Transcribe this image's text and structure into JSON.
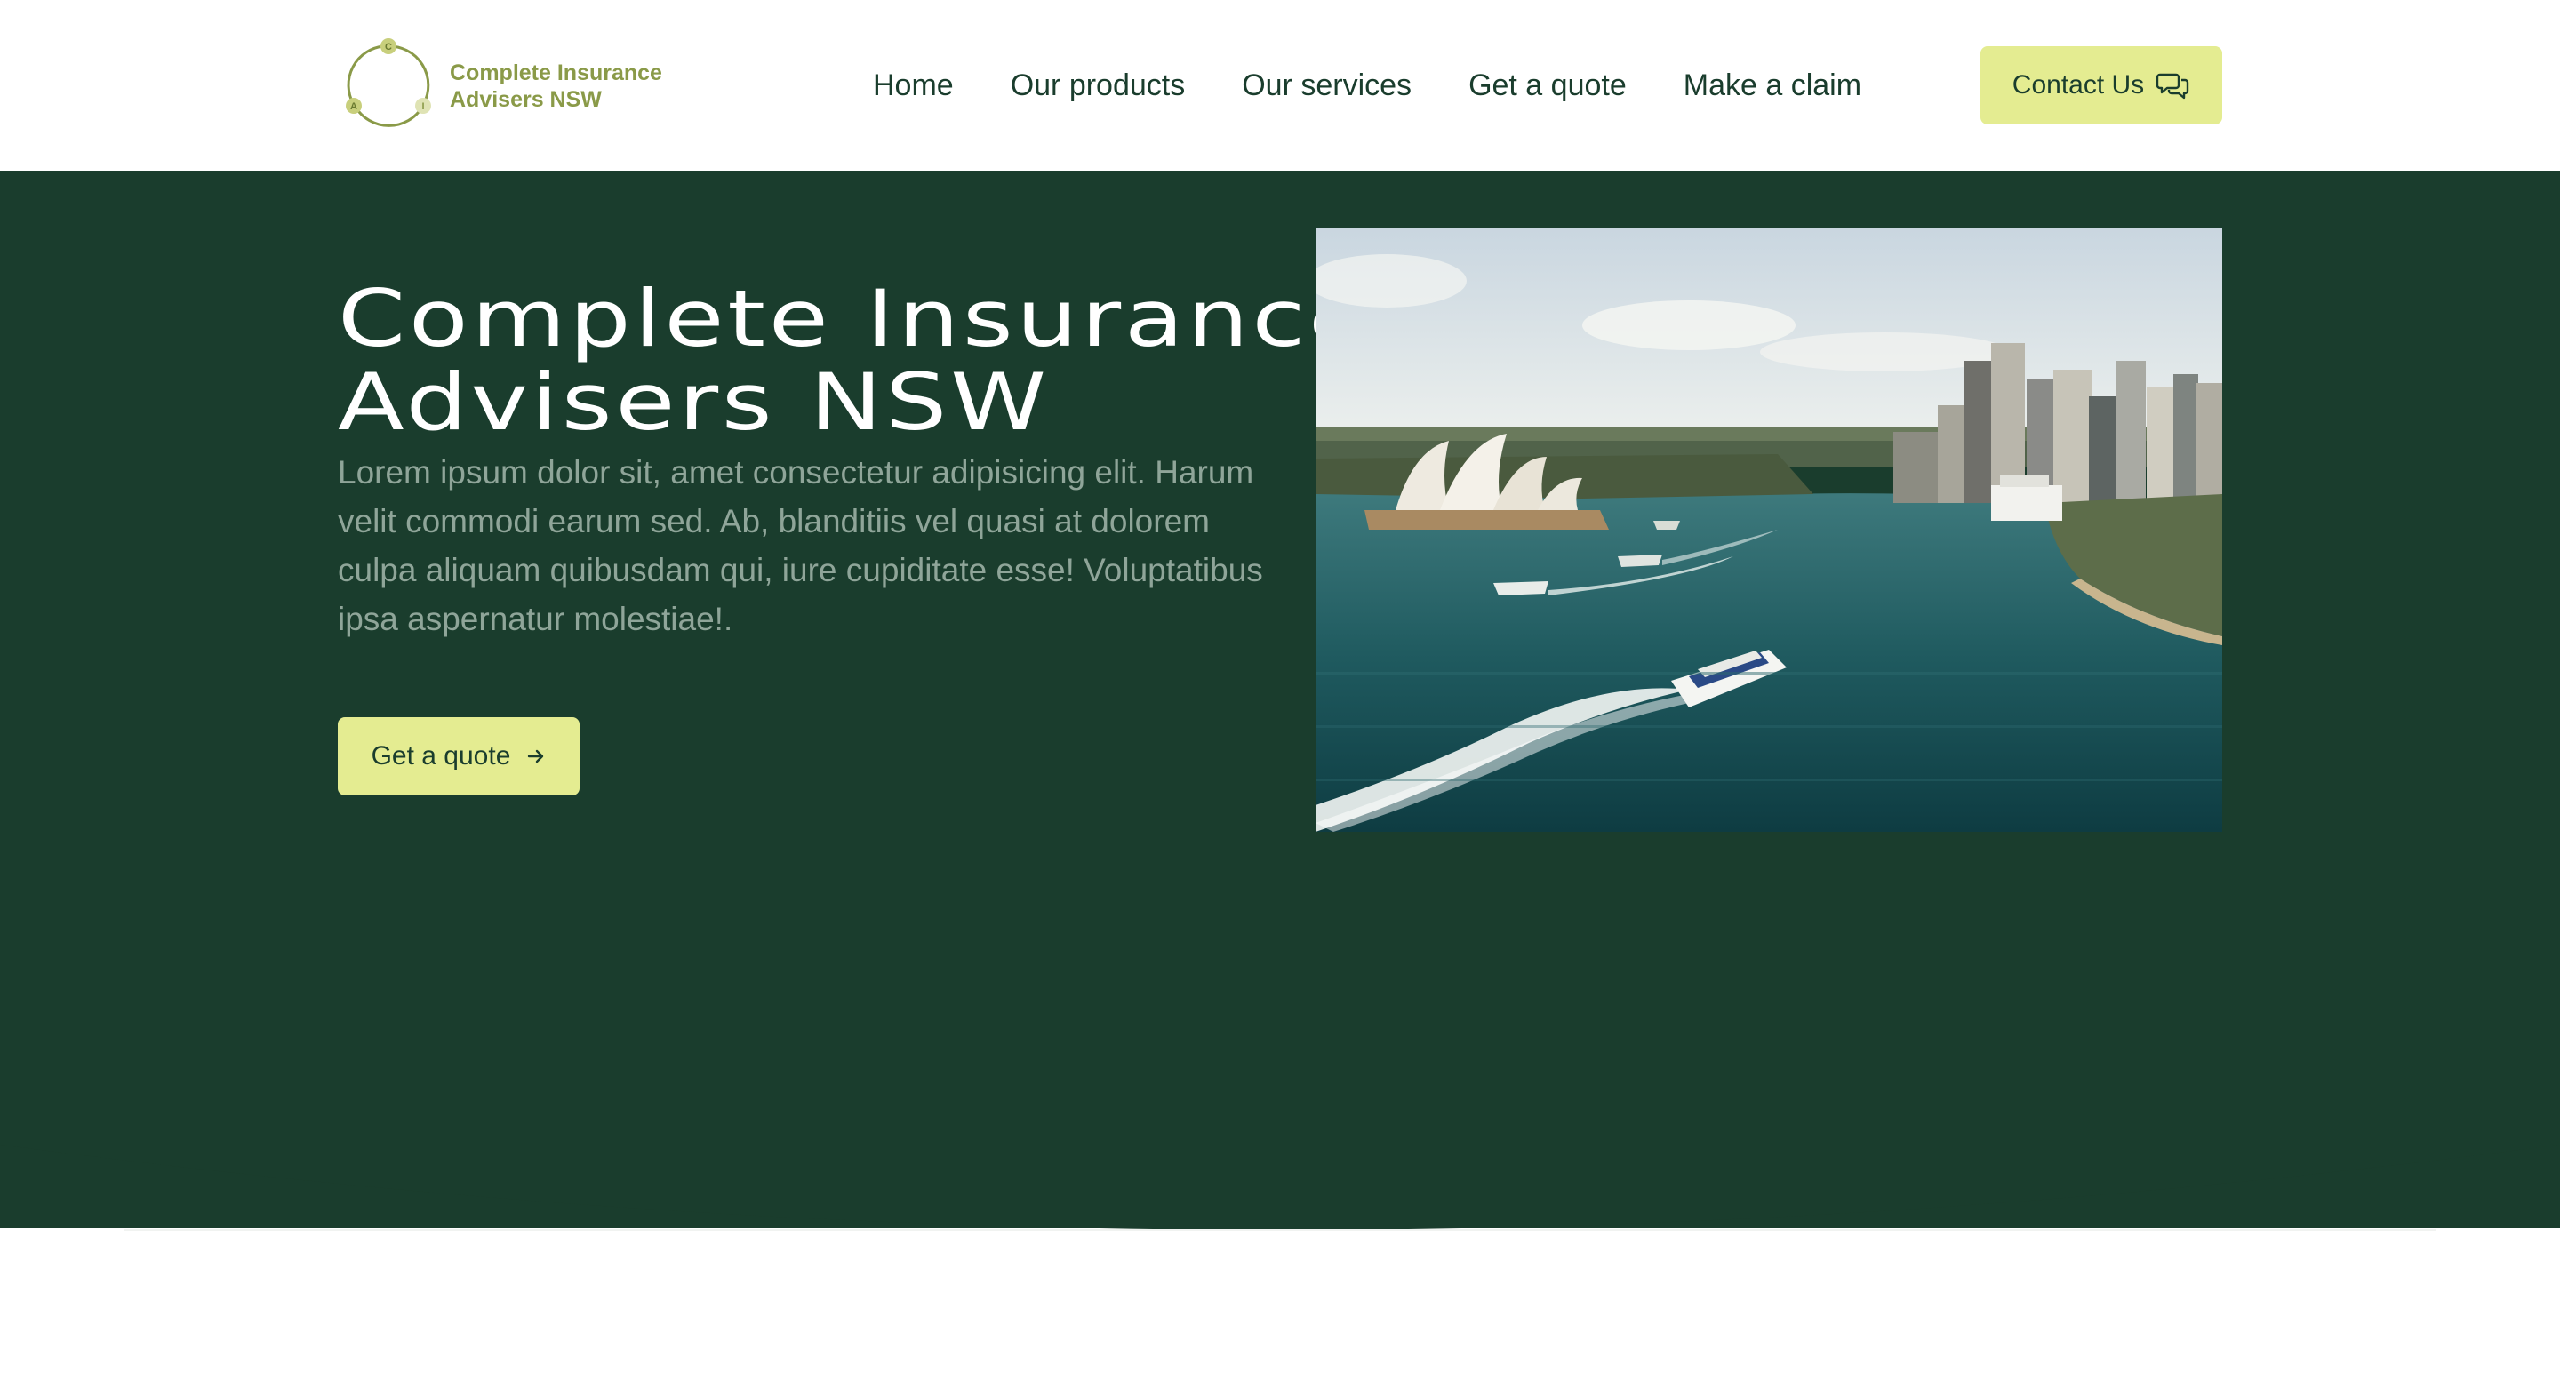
{
  "header": {
    "logo": {
      "line1": "Complete Insurance",
      "line2": "Advisers NSW",
      "letters": [
        "C",
        "A",
        "I"
      ]
    },
    "nav": [
      "Home",
      "Our products",
      "Our services",
      "Get a quote",
      "Make a claim"
    ],
    "contact_label": "Contact Us"
  },
  "hero": {
    "title_line1": "Complete Insurance",
    "title_line2": "Advisers NSW",
    "description": "Lorem ipsum dolor sit, amet consectetur adipisicing elit. Harum velit commodi earum sed. Ab, blanditiis vel quasi at dolorem culpa aliquam quibusdam qui, iure cupiditate esse! Voluptatibus ipsa aspernatur molestiae!.",
    "cta_label": "Get a quote"
  },
  "icons": {
    "contact": "chat-bubbles-icon",
    "cta": "arrow-right-icon"
  },
  "colors": {
    "brand_dark": "#1a3d2d",
    "accent": "#e4ec91",
    "logo_olive": "#8a9a48",
    "muted_text": "#8fa599"
  }
}
